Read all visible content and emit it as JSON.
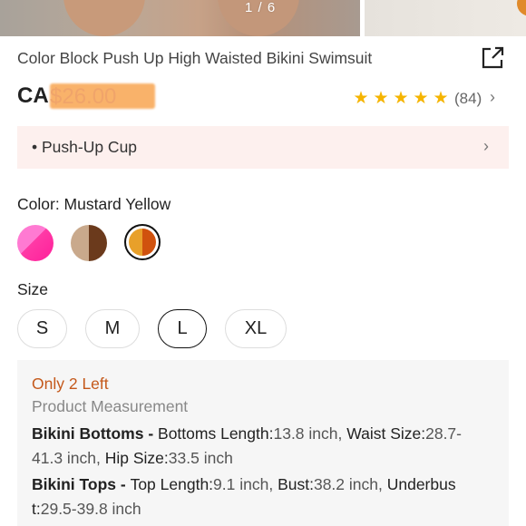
{
  "gallery": {
    "counter": "1 / 6"
  },
  "product": {
    "title": "Color Block Push Up High Waisted Bikini Swimsuit",
    "price_prefix": "CA",
    "price_value": "$26.00",
    "rating": {
      "stars": 4.5,
      "review_count": "(84)"
    },
    "feature": "• Push-Up Cup"
  },
  "color": {
    "label": "Color: Mustard Yellow",
    "swatches": [
      {
        "name": "pink",
        "selected": false,
        "colors": [
          "#ff7ad2",
          "#ff1f9a"
        ]
      },
      {
        "name": "brown",
        "selected": false,
        "colors": [
          "#c9a98c",
          "#6b3a1c"
        ]
      },
      {
        "name": "mustard",
        "selected": true,
        "colors": [
          "#e8a02a",
          "#d0520e"
        ]
      }
    ]
  },
  "size": {
    "label": "Size",
    "options": [
      "S",
      "M",
      "L",
      "XL"
    ],
    "selected": "L"
  },
  "info": {
    "stock": "Only 2 Left",
    "measurement_title": "Product Measurement",
    "lines": [
      {
        "label": "Bikini Bottoms - ",
        "items": [
          {
            "k": "Bottoms Length:",
            "v": "13.8 inch,  "
          },
          {
            "k": "Waist Size:",
            "v": "28.7-"
          }
        ]
      },
      {
        "label": "",
        "items": [
          {
            "k": "",
            "v": "41.3 inch,  "
          },
          {
            "k": "Hip Size:",
            "v": "33.5 inch"
          }
        ]
      },
      {
        "label": "Bikini Tops - ",
        "items": [
          {
            "k": "Top Length:",
            "v": "9.1 inch,  "
          },
          {
            "k": "Bust:",
            "v": "38.2 inch,  "
          },
          {
            "k": "Underbus",
            "v": ""
          }
        ]
      },
      {
        "label": "",
        "items": [
          {
            "k": "t:",
            "v": "29.5-39.8 inch"
          }
        ]
      }
    ]
  }
}
